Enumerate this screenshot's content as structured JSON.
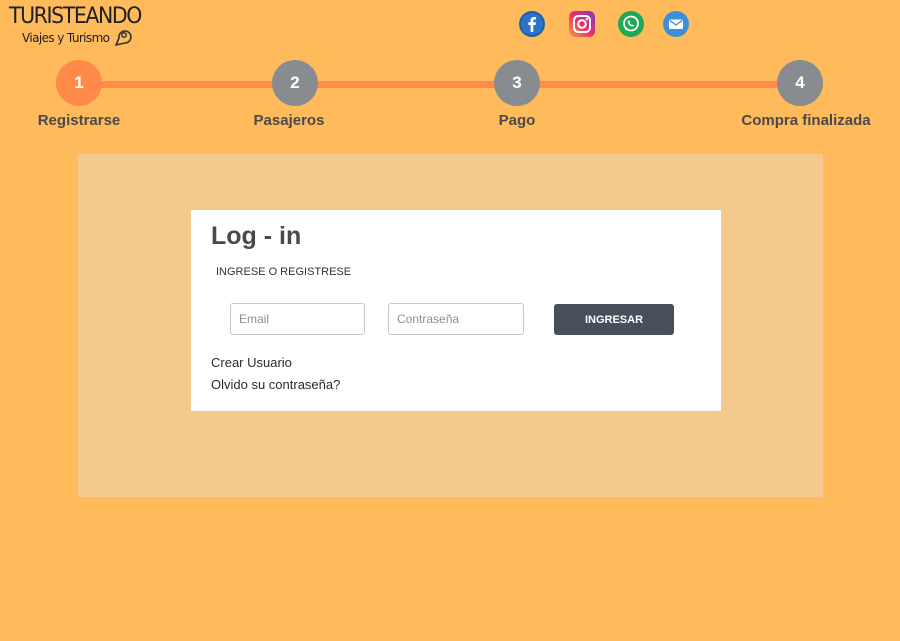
{
  "brand": {
    "name": "TURISTEANDO",
    "tagline": "Viajes y Turismo"
  },
  "social": [
    {
      "icon": "facebook-icon",
      "color": "#1877F2"
    },
    {
      "icon": "instagram-icon",
      "color": "#E1306C"
    },
    {
      "icon": "whatsapp-icon",
      "color": "#25D366"
    },
    {
      "icon": "email-icon",
      "color": "#3B8FD9"
    }
  ],
  "steps": [
    {
      "number": "1",
      "label": "Registrarse",
      "active": true
    },
    {
      "number": "2",
      "label": "Pasajeros",
      "active": false
    },
    {
      "number": "3",
      "label": "Pago",
      "active": false
    },
    {
      "number": "4",
      "label": "Compra finalizada",
      "active": false
    }
  ],
  "login": {
    "title": "Log - in",
    "subtitle": "INGRESE O REGISTRESE",
    "email_placeholder": "Email",
    "password_placeholder": "Contraseña",
    "submit_label": "INGRESAR",
    "create_user_label": "Crear Usuario",
    "forgot_password_label": "Olvido su contraseña?"
  },
  "colors": {
    "background": "#FFBA5C",
    "panel": "#F5C98D",
    "step_active": "#FF8A4A",
    "step_inactive": "#888C91",
    "button": "#474F5A"
  }
}
